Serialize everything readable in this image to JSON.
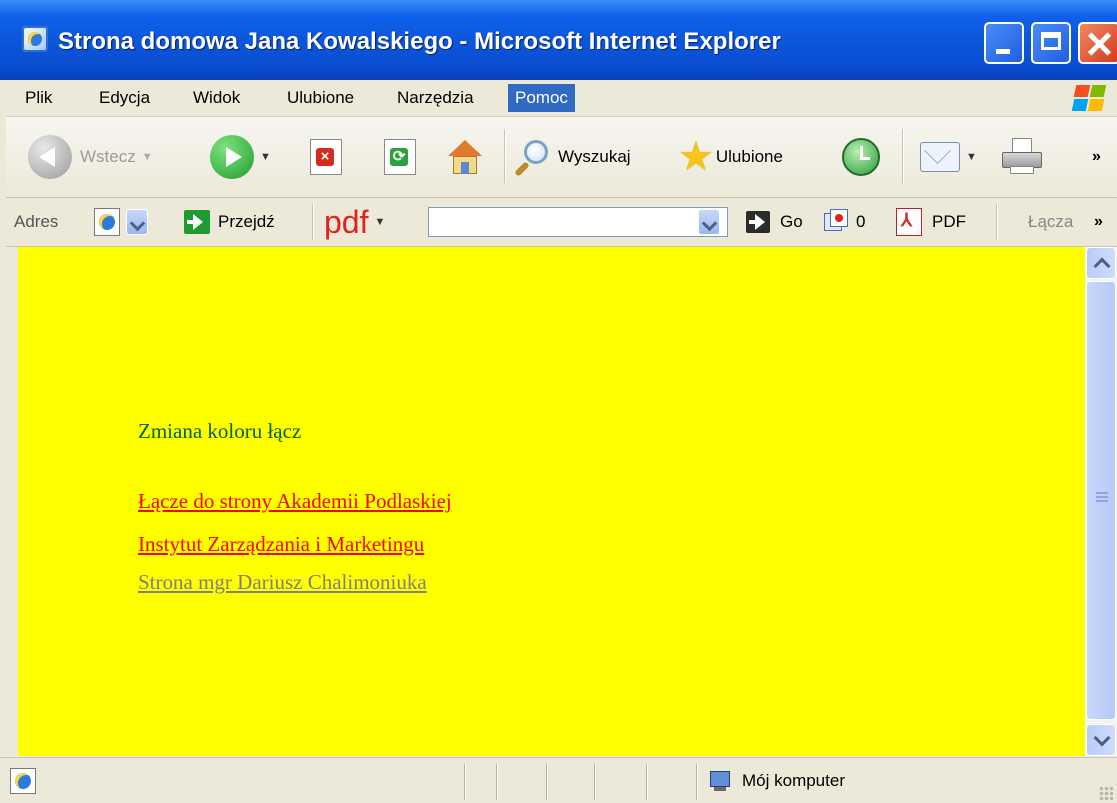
{
  "window": {
    "title": "Strona domowa Jana Kowalskiego - Microsoft Internet Explorer"
  },
  "menu": {
    "items": [
      "Plik",
      "Edycja",
      "Widok",
      "Ulubione",
      "Narzędzia",
      "Pomoc"
    ],
    "active": "Pomoc"
  },
  "toolbar": {
    "back_label": "Wstecz",
    "search_label": "Wyszukaj",
    "favorites_label": "Ulubione",
    "icons": [
      "back-arrow-icon",
      "forward-arrow-icon",
      "stop-icon",
      "refresh-icon",
      "home-icon",
      "search-icon",
      "favorites-star-icon",
      "history-icon",
      "mail-icon",
      "print-icon"
    ]
  },
  "addressbar": {
    "label": "Adres",
    "go_label": "Przejdź",
    "pdf_brand": "pdf",
    "search_value": "",
    "go2_label": "Go",
    "counter_value": "0",
    "pdf_label": "PDF",
    "links_label": "Łącza"
  },
  "content": {
    "background": "#ffff00",
    "heading": "Zmiana koloru łącz",
    "heading_color": "#006400",
    "links": [
      {
        "text": "Łącze do strony Akademii Podlaskiej",
        "color": "#ff0000"
      },
      {
        "text": "Instytut Zarządzania i Marketingu",
        "color": "#ff0000"
      },
      {
        "text": "Strona mgr Dariusz Chalimoniuka",
        "color": "#808080"
      }
    ]
  },
  "statusbar": {
    "zone_label": "Mój komputer"
  }
}
